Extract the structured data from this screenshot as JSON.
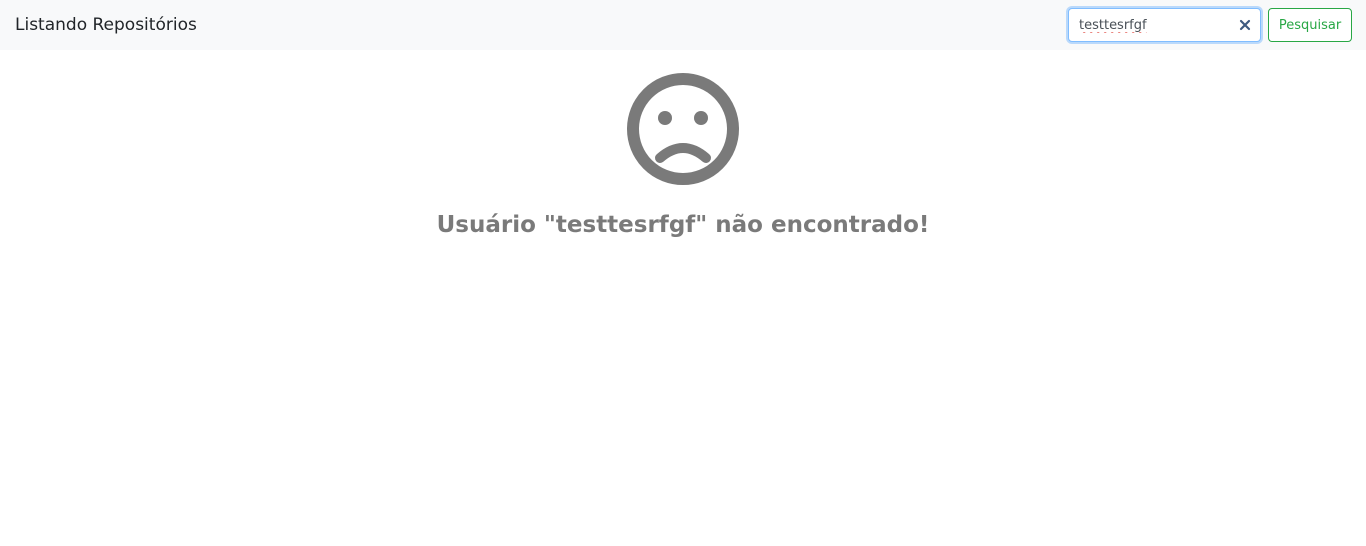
{
  "navbar": {
    "brand": "Listando Repositórios",
    "search": {
      "value": "testtesrfgf",
      "clear_icon": "close-icon"
    },
    "search_button_label": "Pesquisar"
  },
  "empty_state": {
    "icon": "sad-face-icon",
    "message": "Usuário \"testtesrfgf\" não encontrado!"
  },
  "colors": {
    "navbar_bg": "#f8f9fa",
    "accent_green": "#28a745",
    "focus_blue": "#80bdff",
    "icon_gray": "#7a7a7a"
  }
}
